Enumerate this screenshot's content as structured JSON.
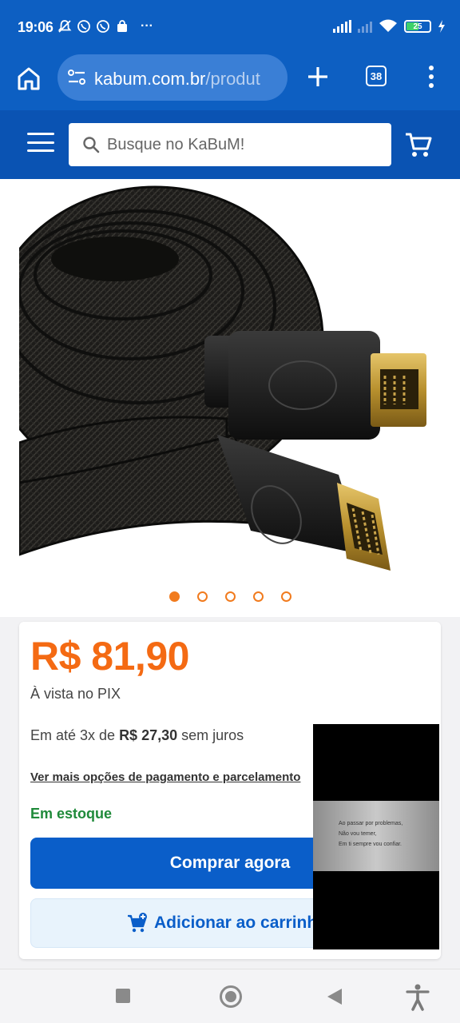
{
  "status_bar": {
    "time": "19:06",
    "notification_icons": [
      "bell-off-icon",
      "whatsapp-icon",
      "whatsapp-icon",
      "shop-bag-icon",
      "more-dots-icon"
    ],
    "more": "···",
    "battery": "25"
  },
  "browser": {
    "url_domain": "kabum.com.br",
    "url_path": "/produt",
    "tab_count": "38"
  },
  "site": {
    "search_placeholder": "Busque no KaBuM!"
  },
  "product": {
    "image_dots": 5,
    "active_dot": 0,
    "price": "R$ 81,90",
    "pix_label": "À vista no PIX",
    "installments_prefix": "Em até 3x de ",
    "installment_value": "R$ 27,30",
    "installments_suffix": " sem juros",
    "more_payment_link": "Ver mais opções de pagamento e parcelamento",
    "stock_status": "Em estoque",
    "buy_now_label": "Comprar agora",
    "add_to_cart_label": "Adicionar ao carrinho"
  },
  "overlay": {
    "lines": [
      "Ao passar por problemas,",
      "Não vou temer,",
      "Em ti sempre vou confiar."
    ]
  },
  "colors": {
    "brand_blue": "#0a53b3",
    "accent_orange": "#f46a13",
    "stock_green": "#1f8a3a"
  }
}
